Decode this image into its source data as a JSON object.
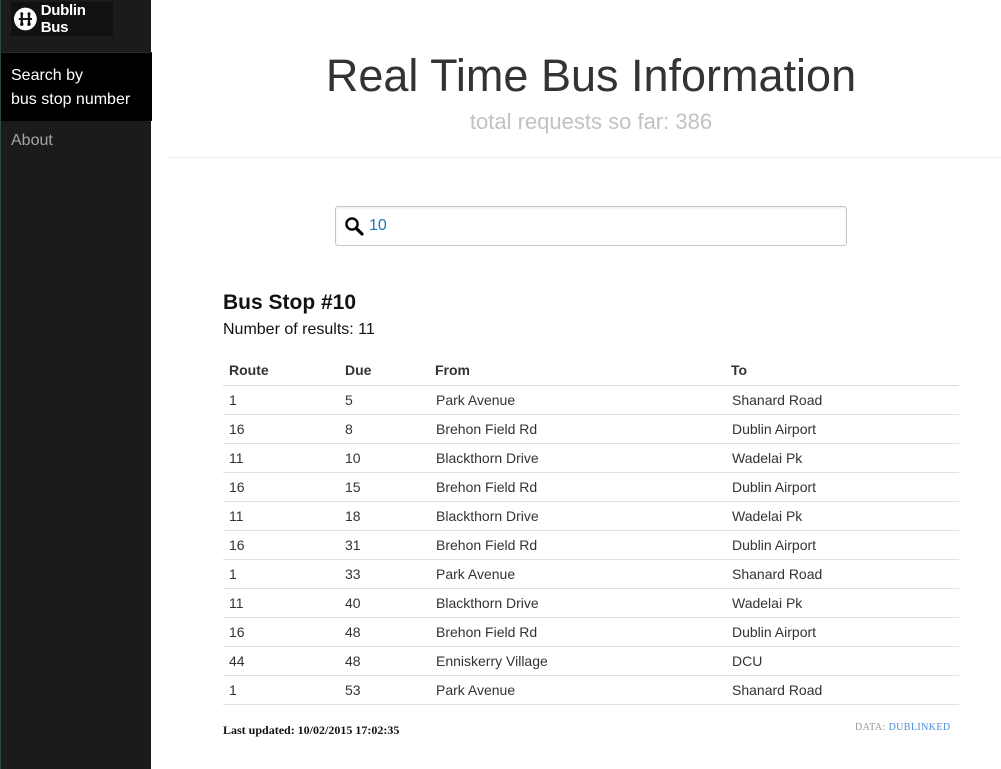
{
  "sidebar": {
    "logo_text": "Dublin Bus",
    "nav_active_line1": "Search by",
    "nav_active_line2": "bus stop number",
    "nav_about": "About"
  },
  "header": {
    "title": "Real Time Bus Information",
    "subtitle": "total requests so far: 386"
  },
  "search": {
    "value": "10",
    "icon": "search-icon"
  },
  "results": {
    "stop_title": "Bus Stop #10",
    "count_text": "Number of results: 11",
    "columns": [
      "Route",
      "Due",
      "From",
      "To"
    ],
    "rows": [
      [
        "1",
        "5",
        "Park Avenue",
        "Shanard Road"
      ],
      [
        "16",
        "8",
        "Brehon Field Rd",
        "Dublin Airport"
      ],
      [
        "11",
        "10",
        "Blackthorn Drive",
        "Wadelai Pk"
      ],
      [
        "16",
        "15",
        "Brehon Field Rd",
        "Dublin Airport"
      ],
      [
        "11",
        "18",
        "Blackthorn Drive",
        "Wadelai Pk"
      ],
      [
        "16",
        "31",
        "Brehon Field Rd",
        "Dublin Airport"
      ],
      [
        "1",
        "33",
        "Park Avenue",
        "Shanard Road"
      ],
      [
        "11",
        "40",
        "Blackthorn Drive",
        "Wadelai Pk"
      ],
      [
        "16",
        "48",
        "Brehon Field Rd",
        "Dublin Airport"
      ],
      [
        "44",
        "48",
        "Enniskerry Village",
        "DCU"
      ],
      [
        "1",
        "53",
        "Park Avenue",
        "Shanard Road"
      ]
    ]
  },
  "footer": {
    "last_updated": "Last updated: 10/02/2015 17:02:35",
    "data_label": "DATA:",
    "data_link": "DUBLINKED"
  },
  "colors": {
    "sidebar_bg": "#1b1b1b",
    "accent_link": "#4a90d9",
    "input_text": "#1a7ab8"
  }
}
